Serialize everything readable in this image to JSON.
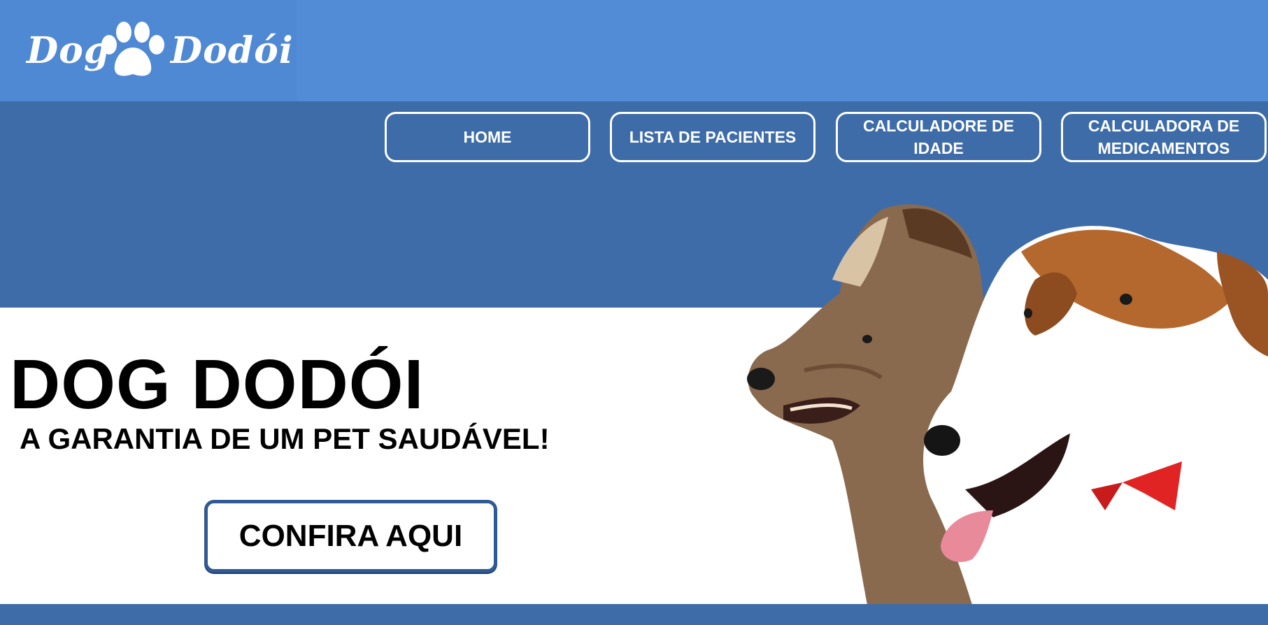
{
  "logo": {
    "word_left": "Dog",
    "word_right": "Dodói",
    "paw_icon": "paw-icon"
  },
  "nav": {
    "home": "HOME",
    "lista": "LISTA DE PACIENTES",
    "idade_line1": "CALCULADORE DE",
    "idade_line2": "IDADE",
    "med_line1": "CALCULADORA DE",
    "med_line2": "MEDICAMENTOS"
  },
  "hero": {
    "title": "DOG DODÓI",
    "subtitle": "A GARANTIA DE UM PET SAUDÁVEL!",
    "cta": "CONFIRA AQUI",
    "image": "two-dogs-photo"
  },
  "colors": {
    "topbar": "#528bd6",
    "navband": "#3d6ca8",
    "cta_border": "#2f5a93"
  }
}
